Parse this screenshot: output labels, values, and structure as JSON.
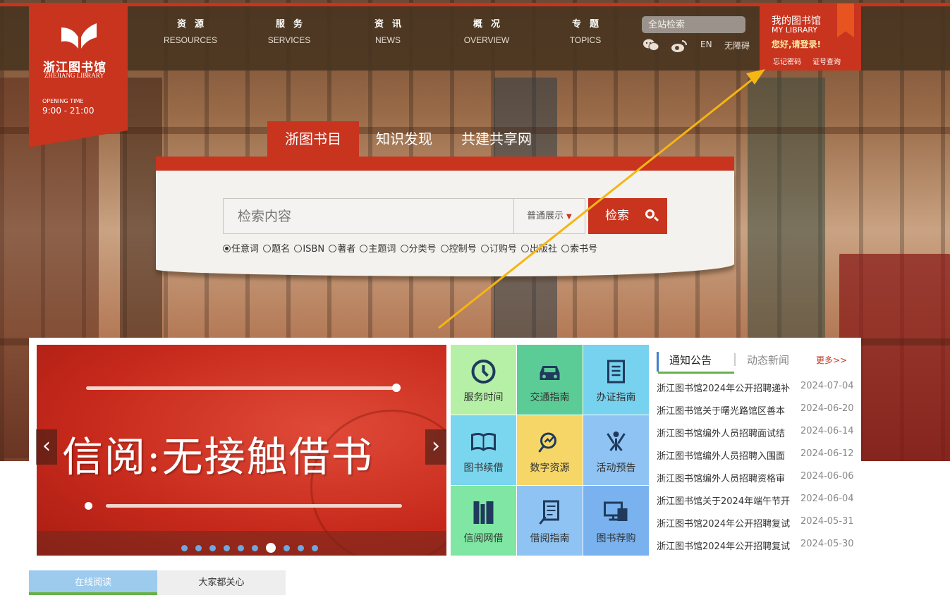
{
  "header": {
    "logo_cn": "浙江图书馆",
    "logo_en": "ZHEJIANG LIBRARY",
    "opening_label": "OPENING TIME",
    "opening_hours": "9:00 - 21:00",
    "nav": [
      {
        "cn": "资源",
        "en": "RESOURCES"
      },
      {
        "cn": "服务",
        "en": "SERVICES"
      },
      {
        "cn": "资讯",
        "en": "NEWS"
      },
      {
        "cn": "概况",
        "en": "OVERVIEW"
      },
      {
        "cn": "专题",
        "en": "TOPICS"
      }
    ],
    "site_search_placeholder": "全站检索",
    "lang": "EN",
    "accessibility": "无障碍",
    "wechat_icon": "wechat-icon",
    "weibo_icon": "weibo-icon"
  },
  "my_library": {
    "title": "我的图书馆",
    "subtitle": "MY LIBRARY",
    "greeting": "您好,请登录!",
    "forgot_password": "忘记密码",
    "card_query": "证号查询"
  },
  "search": {
    "tabs": [
      "浙图书目",
      "知识发现",
      "共建共享网"
    ],
    "placeholder": "检索内容",
    "mode": "普通展示",
    "button": "检索",
    "fields": [
      "任意词",
      "题名",
      "ISBN",
      "著者",
      "主题词",
      "分类号",
      "控制号",
      "订购号",
      "出版社",
      "索书号"
    ],
    "selected_field": "任意词"
  },
  "banner": {
    "title": "信阅:无接触借书",
    "slide_count": 10,
    "current_slide": 7
  },
  "quick_links": [
    {
      "label": "服务时间",
      "icon": "clock-icon",
      "color": "#b5f0a6"
    },
    {
      "label": "交通指南",
      "icon": "car-icon",
      "color": "#5ccc96"
    },
    {
      "label": "办证指南",
      "icon": "card-icon",
      "color": "#76d2ee"
    },
    {
      "label": "图书续借",
      "icon": "book-icon",
      "color": "#7ad6ef"
    },
    {
      "label": "数字资源",
      "icon": "digital-icon",
      "color": "#f6d667"
    },
    {
      "label": "活动预告",
      "icon": "event-icon",
      "color": "#8fc3f3"
    },
    {
      "label": "信阅网借",
      "icon": "books-icon",
      "color": "#7fe7a3"
    },
    {
      "label": "借阅指南",
      "icon": "document-icon",
      "color": "#8fc3f3"
    },
    {
      "label": "图书荐购",
      "icon": "computer-icon",
      "color": "#79b2ef"
    }
  ],
  "news": {
    "tabs": [
      "通知公告",
      "动态新闻"
    ],
    "more": "更多>>",
    "items": [
      {
        "title": "浙江图书馆2024年公开招聘递补",
        "date": "2024-07-04"
      },
      {
        "title": "浙江图书馆关于曙光路馆区善本",
        "date": "2024-06-20"
      },
      {
        "title": "浙江图书馆编外人员招聘面试结",
        "date": "2024-06-14"
      },
      {
        "title": "浙江图书馆编外人员招聘入围面",
        "date": "2024-06-12"
      },
      {
        "title": "浙江图书馆编外人员招聘资格审",
        "date": "2024-06-06"
      },
      {
        "title": "浙江图书馆关于2024年端午节开",
        "date": "2024-06-04"
      },
      {
        "title": "浙江图书馆2024年公开招聘复试",
        "date": "2024-05-31"
      },
      {
        "title": "浙江图书馆2024年公开招聘复试",
        "date": "2024-05-30"
      }
    ]
  },
  "bottom_tabs": [
    "在线阅读",
    "大家都关心"
  ],
  "colors": {
    "brand_red": "#c8341e",
    "nav_bg": "#48341f",
    "arrow": "#f5b512"
  }
}
